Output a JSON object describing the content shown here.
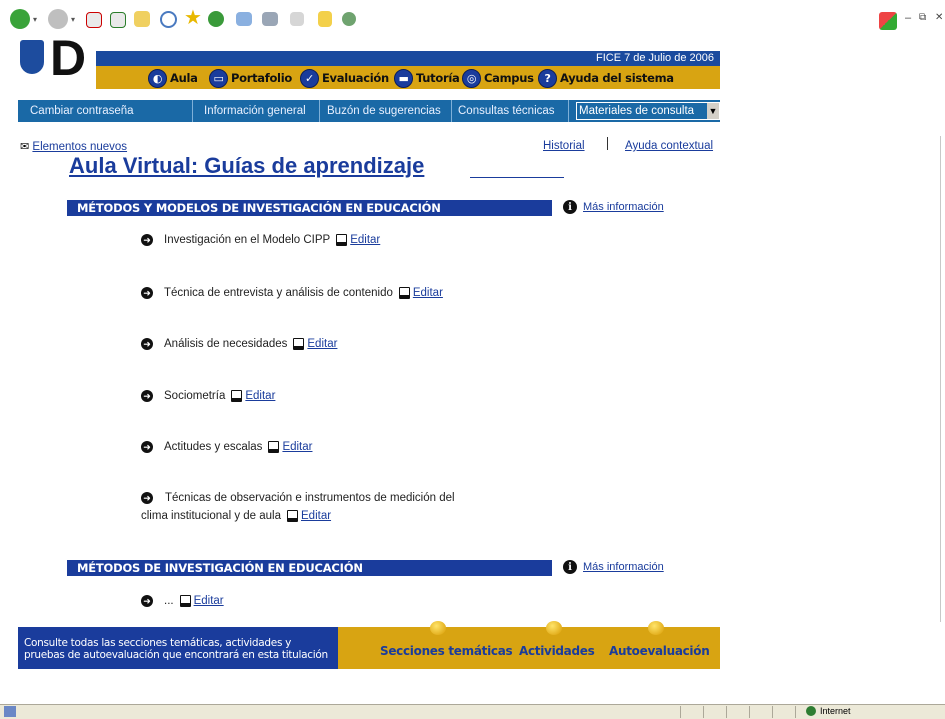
{
  "header": {
    "date_text": "FICE 7 de Julio de 2006",
    "nav_top": [
      {
        "label": "Aula",
        "icon": "aula-icon"
      },
      {
        "label": "Portafolio",
        "icon": "portfolio-icon"
      },
      {
        "label": "Evaluación",
        "icon": "check-icon"
      },
      {
        "label": "Tutoría",
        "icon": "chat-icon"
      },
      {
        "label": "Campus",
        "icon": "target-icon"
      },
      {
        "label": "Ayuda del sistema",
        "icon": "help-icon"
      }
    ],
    "nav_second": [
      "Cambiar contraseña",
      "Información general",
      "Buzón de sugerencias",
      "Consultas técnicas"
    ],
    "select_value": "Materiales de consulta"
  },
  "links": {
    "new_items": "Elementos nuevos",
    "history": "Historial",
    "help": "Ayuda contextual"
  },
  "page_title": "Aula Virtual: Guías de aprendizaje",
  "sections": [
    {
      "title": "MÉTODOS Y MODELOS DE INVESTIGACIÓN EN EDUCACIÓN",
      "more_info": "Más información",
      "items": [
        {
          "label": "Investigación en el Modelo CIPP",
          "edit": "Editar"
        },
        {
          "label": "Técnica de entrevista y análisis de contenido",
          "edit": "Editar"
        },
        {
          "label": "Análisis de necesidades",
          "edit": "Editar"
        },
        {
          "label": "Sociometría",
          "edit": "Editar"
        },
        {
          "label": "Actitudes y escalas",
          "edit": "Editar"
        },
        {
          "label_line1": "Técnicas de observación e instrumentos de medición del",
          "label_line2": "clima institucional y de aula",
          "edit": "Editar"
        }
      ]
    },
    {
      "title": "MÉTODOS DE INVESTIGACIÓN EN EDUCACIÓN",
      "more_info": "Más información",
      "items": [
        {
          "label": "...",
          "edit": "Editar"
        }
      ]
    }
  ],
  "footer": {
    "text_line1": "Consulte todas las secciones temáticas, actividades y",
    "text_line2": "pruebas de autoevaluación que encontrará en esta titulación",
    "links": [
      "Secciones temáticas",
      "Actividades",
      "Autoevaluación"
    ]
  },
  "status": {
    "zone": "Internet"
  },
  "colors": {
    "navy": "#1a3c9c",
    "gold": "#d8a412",
    "nav_blue": "#1a69a6"
  }
}
